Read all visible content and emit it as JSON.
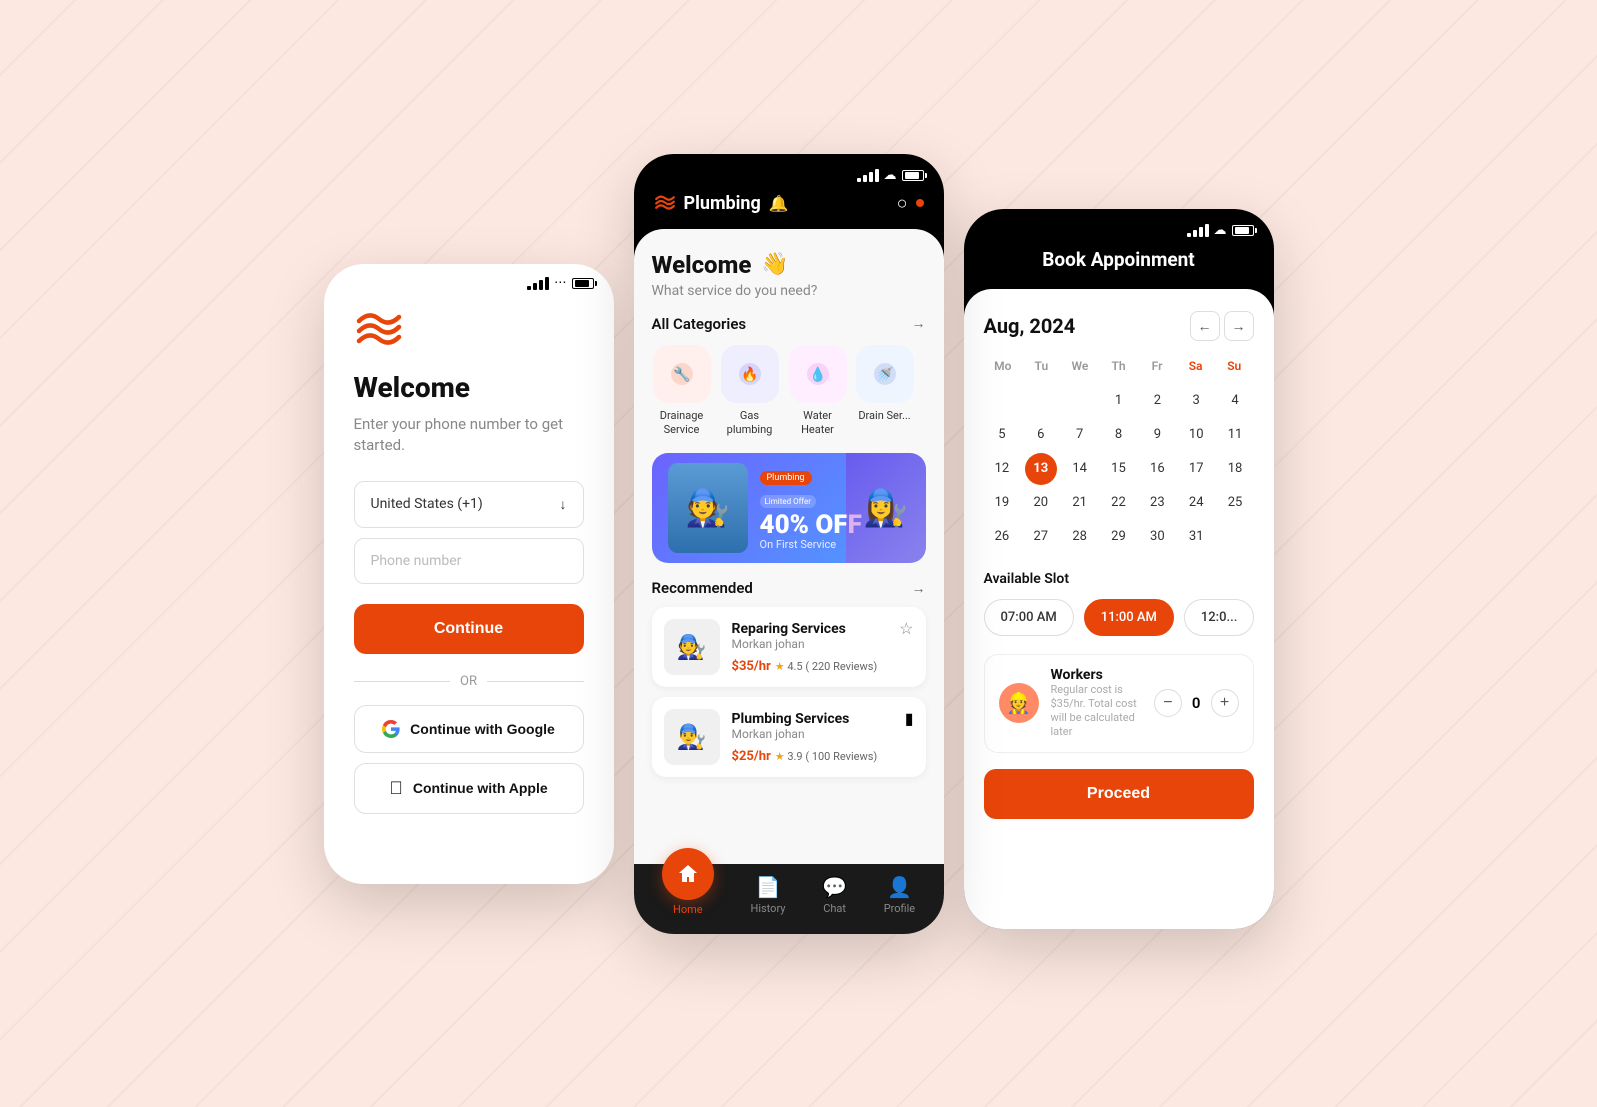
{
  "background": "#fce8e0",
  "phone1": {
    "title": "Welcome",
    "subtitle": "Enter your phone number to get started.",
    "country_selector": "United States (+1)",
    "phone_placeholder": "Phone number",
    "continue_label": "Continue",
    "or_label": "OR",
    "google_label": "Continue with Google",
    "apple_label": "Continue with Apple"
  },
  "phone2": {
    "app_name": "Plumbing",
    "welcome_text": "Welcome",
    "service_question": "What service do you need?",
    "all_categories": "All  Categories",
    "categories": [
      {
        "name": "Drainage Service",
        "color": "#fff0ee",
        "icon": "🔧"
      },
      {
        "name": "Gas plumbing",
        "color": "#eeefff",
        "icon": "🔥"
      },
      {
        "name": "Water Heater",
        "color": "#ffeeff",
        "icon": "💧"
      },
      {
        "name": "Drain Ser...",
        "color": "#eef5ff",
        "icon": "🚿"
      }
    ],
    "promo": {
      "badge": "Plumbing",
      "limited": "Limited Offer",
      "percent": "40% OFF",
      "subtext": "On First Service"
    },
    "recommended_label": "Recommended",
    "services": [
      {
        "name": "Reparing Services",
        "provider": "Morkan johan",
        "price": "$35/hr",
        "rating": "4.5 ( 220 Reviews)",
        "bookmarked": false
      },
      {
        "name": "Plumbing Services",
        "provider": "Morkan johan",
        "price": "$25/hr",
        "rating": "3.9 ( 100 Reviews)",
        "bookmarked": true
      }
    ],
    "nav": [
      {
        "label": "Home",
        "icon": "🏠",
        "active": true
      },
      {
        "label": "History",
        "icon": "📄",
        "active": false
      },
      {
        "label": "Chat",
        "icon": "💬",
        "active": false
      },
      {
        "label": "Profile",
        "icon": "👤",
        "active": false
      }
    ]
  },
  "phone3": {
    "title": "Book Appoinment",
    "month": "Aug, 2024",
    "days_header": [
      "Mo",
      "Tu",
      "We",
      "Th",
      "Fr",
      "Sa",
      "Su"
    ],
    "calendar": {
      "offset": 3,
      "days": 31,
      "selected": 13
    },
    "available_slot": "Available Slot",
    "time_slots": [
      "07:00 AM",
      "11:00 AM",
      "12:0..."
    ],
    "selected_slot": 1,
    "workers_label": "Workers",
    "workers_subtitle": "Regular cost is $35/hr. Total cost will be calculated later",
    "workers_count": 0,
    "proceed_label": "Proceed"
  }
}
